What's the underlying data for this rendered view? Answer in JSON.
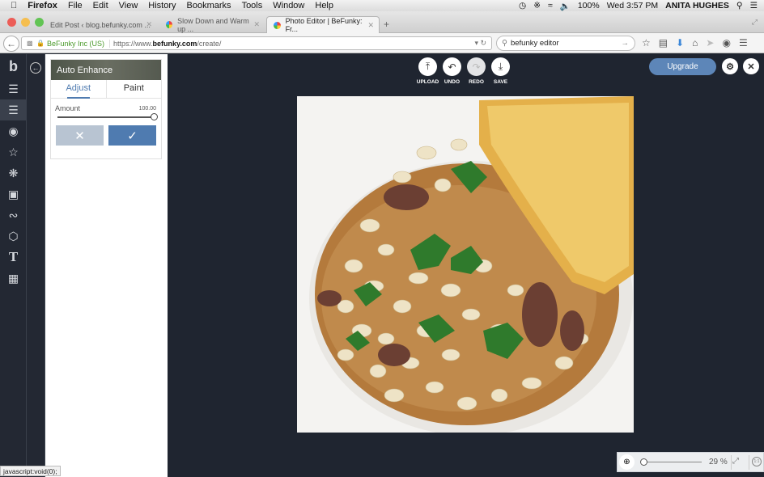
{
  "os_menubar": {
    "app": "Firefox",
    "menus": [
      "File",
      "Edit",
      "View",
      "History",
      "Bookmarks",
      "Tools",
      "Window",
      "Help"
    ],
    "battery": "100%",
    "clock": "Wed 3:57 PM",
    "user": "ANITA HUGHES"
  },
  "browser": {
    "tabs": [
      {
        "title": "Edit Post ‹ blog.befunky.com ...",
        "active": false
      },
      {
        "title": "Slow Down and Warm up ...",
        "active": false
      },
      {
        "title": "Photo Editor | BeFunky: Fr...",
        "active": true
      }
    ],
    "new_tab": "+",
    "site_identity": "BeFunky Inc (US)",
    "url_prefix": "https://www.",
    "url_domain": "befunky.com",
    "url_path": "/create/",
    "search_value": "befunky editor",
    "status_text": "javascript:void(0);"
  },
  "editor": {
    "panel": {
      "title": "Auto Enhance",
      "tabs": [
        "Adjust",
        "Paint"
      ],
      "active_tab": "Adjust",
      "amount_label": "Amount",
      "amount_value": "100.00",
      "amount_fraction": 1.0
    },
    "toolbar": {
      "upload": "UPLOAD",
      "undo": "UNDO",
      "redo": "REDO",
      "save": "SAVE"
    },
    "upgrade_label": "Upgrade",
    "zoom_percent": "29 %",
    "zoom_fraction": 0.0,
    "sidebar_tools": [
      "logo",
      "layers",
      "edit",
      "touch-up",
      "effects",
      "artsy",
      "frames",
      "graphics",
      "overlays",
      "text",
      "textures"
    ],
    "active_tool": "edit",
    "photo_description": "Bowl of white bean stew with sausage, parsley and toasted bread"
  }
}
